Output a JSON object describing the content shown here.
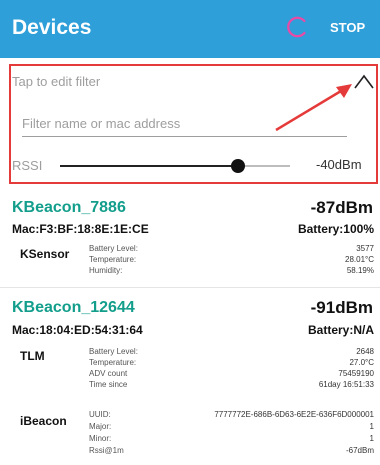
{
  "appbar": {
    "title": "Devices",
    "stop_label": "STOP",
    "color": "#2e9fd8",
    "spinner_color": "#e94aa5"
  },
  "filter": {
    "hint": "Tap to edit filter",
    "placeholder": "Filter name or mac address",
    "value": "",
    "rssi_label": "RSSI",
    "rssi_value": "-40dBm",
    "rssi_fraction": 0.78,
    "border_color": "#e53a3a"
  },
  "devices": [
    {
      "name": "KBeacon_7886",
      "rssi": "-87dBm",
      "mac": "Mac:F3:BF:18:8E:1E:CE",
      "battery": "Battery:100%",
      "sections": [
        {
          "title": "KSensor",
          "rows": [
            {
              "key": "Battery Level:",
              "value": "3577"
            },
            {
              "key": "Temperature:",
              "value": "28.01°C"
            },
            {
              "key": "Humidity:",
              "value": "58.19%"
            }
          ]
        }
      ]
    },
    {
      "name": "KBeacon_12644",
      "rssi": "-91dBm",
      "mac": "Mac:18:04:ED:54:31:64",
      "battery": "Battery:N/A",
      "sections": [
        {
          "title": "TLM",
          "rows": [
            {
              "key": "Battery Level:",
              "value": "2648"
            },
            {
              "key": "Temperature:",
              "value": "27.0°C"
            },
            {
              "key": "ADV count",
              "value": "75459190"
            },
            {
              "key": "Time since",
              "value": "61day 16:51:33"
            }
          ]
        },
        {
          "title": "iBeacon",
          "rows": [
            {
              "key": "UUID:",
              "value": "7777772E-686B-6D63-6E2E-636F6D000001"
            },
            {
              "key": "Major:",
              "value": "1"
            },
            {
              "key": "Minor:",
              "value": "1"
            },
            {
              "key": "Rssi@1m",
              "value": "-67dBm"
            }
          ]
        }
      ]
    }
  ]
}
